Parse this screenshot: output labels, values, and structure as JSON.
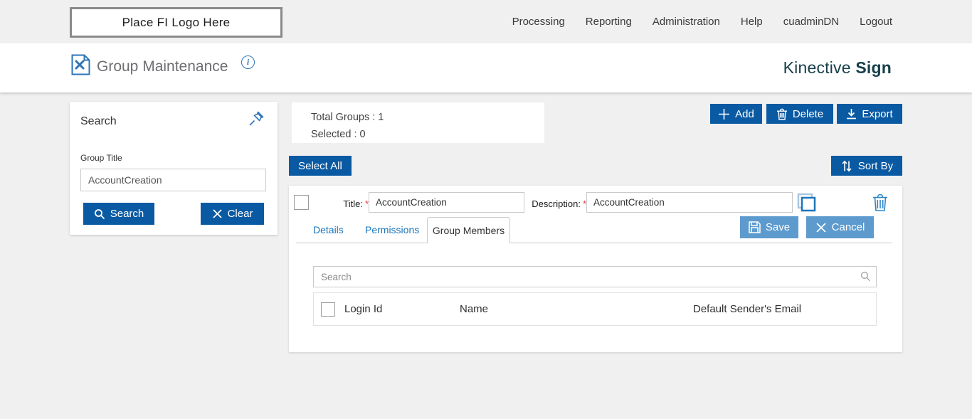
{
  "topbar": {
    "logo_placeholder": "Place FI Logo Here",
    "nav": [
      {
        "label": "Processing"
      },
      {
        "label": "Reporting"
      },
      {
        "label": "Administration"
      },
      {
        "label": "Help"
      },
      {
        "label": "cuadminDN"
      },
      {
        "label": "Logout"
      }
    ]
  },
  "header": {
    "title": "Group Maintenance",
    "info_glyph": "i",
    "brand_name": "Kinective",
    "brand_product": "Sign"
  },
  "search_panel": {
    "title": "Search",
    "group_title_label": "Group Title",
    "group_title_value": "AccountCreation",
    "search_button": "Search",
    "clear_button": "Clear"
  },
  "summary": {
    "total_groups_text": "Total Groups : 1",
    "selected_text": "Selected : 0"
  },
  "toolbar": {
    "add_label": "Add",
    "delete_label": "Delete",
    "export_label": "Export",
    "select_all_label": "Select All",
    "sort_by_label": "Sort By"
  },
  "group_row": {
    "title_label": "Title:",
    "required_marker": "*",
    "title_value": "AccountCreation",
    "description_label": "Description:",
    "description_value": "AccountCreation"
  },
  "tabs": [
    {
      "label": "Details",
      "active": false
    },
    {
      "label": "Permissions",
      "active": false
    },
    {
      "label": "Group Members",
      "active": true
    }
  ],
  "row_actions": {
    "save_label": "Save",
    "cancel_label": "Cancel"
  },
  "members": {
    "search_placeholder": "Search",
    "columns": [
      "Login Id",
      "Name",
      "Default Sender's Email"
    ]
  },
  "colors": {
    "primary_button": "#0a5aa3",
    "muted_button": "#5d9acd",
    "link_blue": "#1b76bc",
    "icon_blue": "#2e75b6",
    "brand_teal": "#163f4a",
    "page_background": "#f0f0f0"
  }
}
